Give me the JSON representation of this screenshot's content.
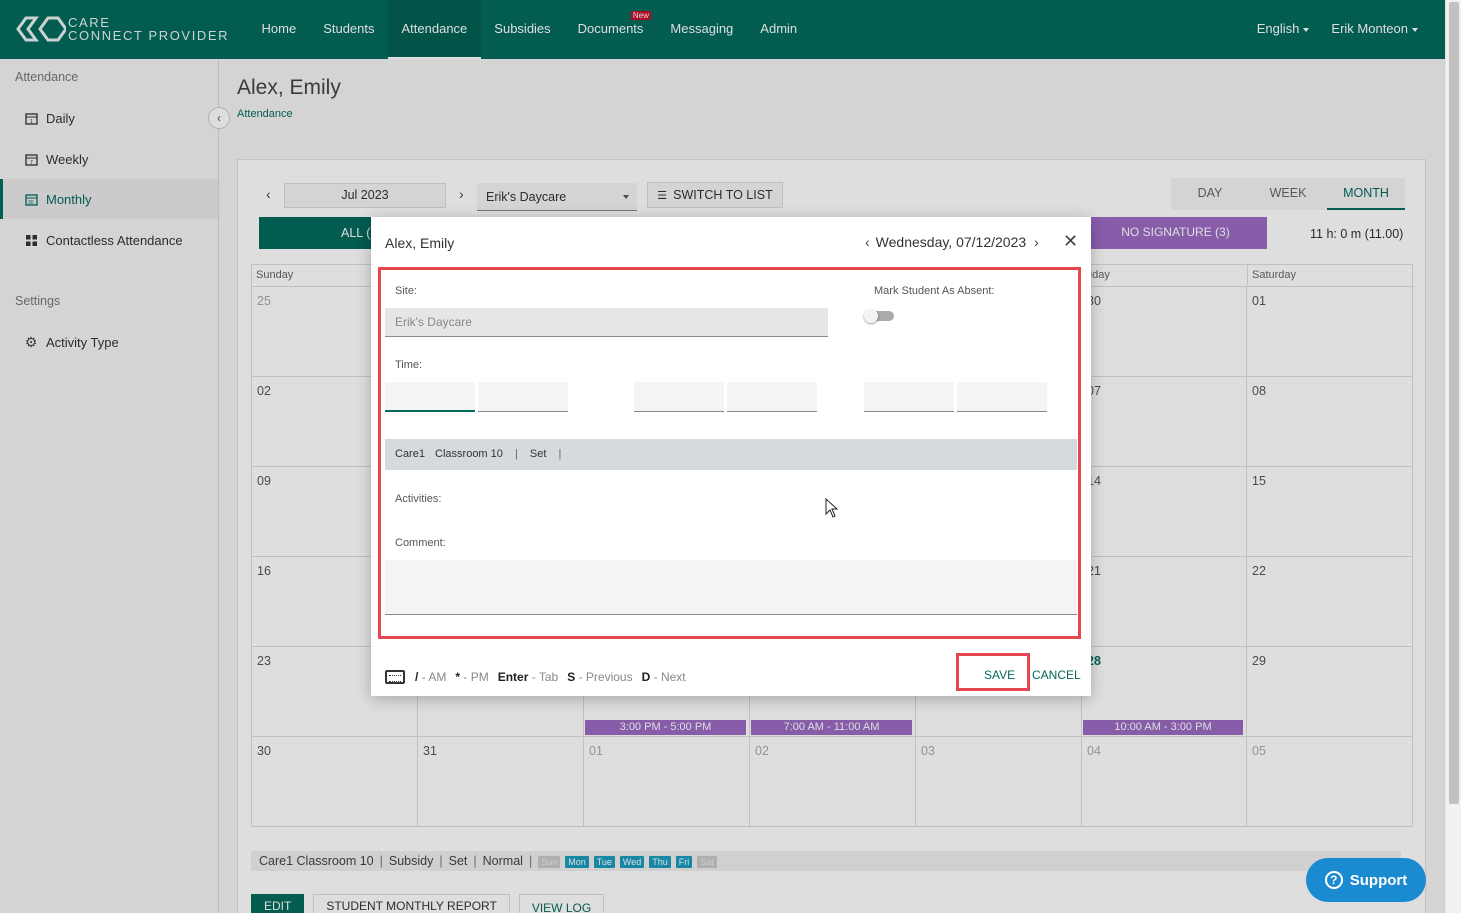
{
  "brand": {
    "line1": "CARE",
    "line2": "CONNECT PROVIDER"
  },
  "nav": {
    "items": [
      "Home",
      "Students",
      "Attendance",
      "Subsidies",
      "Documents",
      "Messaging",
      "Admin"
    ],
    "active": "Attendance",
    "documents_badge": "New",
    "language": "English",
    "user": "Erik Monteon"
  },
  "sidebar": {
    "section_attendance": "Attendance",
    "items": [
      {
        "label": "Daily",
        "icon": "calendar-icon"
      },
      {
        "label": "Weekly",
        "icon": "calendar-icon"
      },
      {
        "label": "Monthly",
        "icon": "calendar-icon"
      },
      {
        "label": "Contactless Attendance",
        "icon": "grid-icon"
      }
    ],
    "active": "Monthly",
    "section_settings": "Settings",
    "settings_items": [
      {
        "label": "Activity Type",
        "icon": "gear-icon"
      }
    ]
  },
  "page": {
    "title": "Alex, Emily",
    "breadcrumb": "Attendance"
  },
  "toolbar": {
    "month": "Jul 2023",
    "site": "Erik's Daycare",
    "switch_label": "SWITCH TO LIST",
    "views": [
      "DAY",
      "WEEK",
      "MONTH"
    ],
    "active_view": "MONTH"
  },
  "filters": {
    "all": "ALL (",
    "no_signature": "NO SIGNATURE (3)",
    "total_hours": "11 h: 0 m (11.00)"
  },
  "calendar": {
    "weekdays": [
      "Sunday",
      "",
      "",
      "",
      "",
      "riday",
      "Saturday"
    ],
    "weeks": [
      [
        "25",
        "",
        "",
        "",
        "",
        "30",
        "01"
      ],
      [
        "02",
        "",
        "",
        "",
        "",
        "07",
        "08"
      ],
      [
        "09",
        "",
        "",
        "",
        "",
        "14",
        "15"
      ],
      [
        "16",
        "",
        "",
        "",
        "",
        "21",
        "22"
      ],
      [
        "23",
        "",
        "",
        "",
        "",
        "28",
        "29"
      ],
      [
        "30",
        "31",
        "01",
        "02",
        "03",
        "04",
        "05"
      ]
    ],
    "events": [
      {
        "week": 4,
        "day": 2,
        "label": "3:00 PM - 5:00 PM"
      },
      {
        "week": 4,
        "day": 3,
        "label": "7:00 AM - 11:00 AM"
      },
      {
        "week": 4,
        "day": 5,
        "label": "10:00 AM - 3:00 PM"
      }
    ]
  },
  "legend": {
    "classroom": "Care1 Classroom 10",
    "subsidy": "Subsidy",
    "set": "Set",
    "mode": "Normal",
    "days": [
      {
        "label": "Sun",
        "on": false
      },
      {
        "label": "Mon",
        "on": true
      },
      {
        "label": "Tue",
        "on": true
      },
      {
        "label": "Wed",
        "on": true
      },
      {
        "label": "Thu",
        "on": true
      },
      {
        "label": "Fri",
        "on": true
      },
      {
        "label": "Sat",
        "on": false
      }
    ]
  },
  "bottom": {
    "edit": "EDIT",
    "report": "STUDENT MONTHLY REPORT",
    "log": "VIEW LOG"
  },
  "support": "Support",
  "modal": {
    "student": "Alex, Emily",
    "date": "Wednesday, 07/12/2023",
    "site_label": "Site:",
    "site_value": "Erik's Daycare",
    "absent_label": "Mark Student As Absent:",
    "time_label": "Time:",
    "class_bar": {
      "site": "Care1",
      "classroom": "Classroom 10",
      "set": "Set"
    },
    "activities_label": "Activities:",
    "comment_label": "Comment:",
    "shortcuts": [
      {
        "key": "/",
        "desc": "- AM"
      },
      {
        "key": "*",
        "desc": "- PM"
      },
      {
        "key": "Enter",
        "desc": "- Tab"
      },
      {
        "key": "S",
        "desc": "- Previous"
      },
      {
        "key": "D",
        "desc": "- Next"
      }
    ],
    "save": "SAVE",
    "cancel": "CANCEL"
  },
  "colors": {
    "brand": "#046a5c",
    "purple": "#9b6bc4",
    "highlight": "#e5454f",
    "support": "#1b8bd1"
  }
}
